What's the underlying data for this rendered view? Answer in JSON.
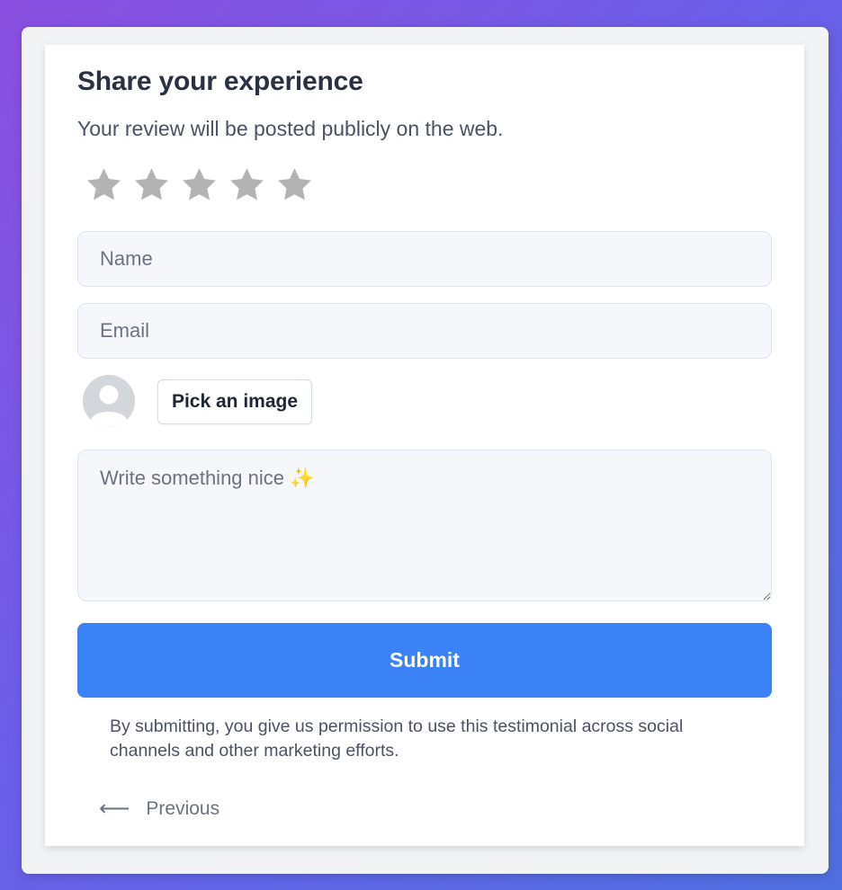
{
  "form": {
    "title": "Share your experience",
    "subtitle": "Your review will be posted publicly on the web.",
    "rating": {
      "max": 5,
      "selected": 0,
      "star_color": "#b3b3b3"
    },
    "name_placeholder": "Name",
    "name_value": "",
    "email_placeholder": "Email",
    "email_value": "",
    "avatar_icon": "user-avatar-placeholder-icon",
    "pick_image_label": "Pick an image",
    "message_placeholder": "Write something nice ✨",
    "message_value": "",
    "submit_label": "Submit",
    "disclaimer": "By submitting, you give us permission to use this testimonial across social channels and other marketing efforts.",
    "previous_label": "Previous",
    "previous_icon": "arrow-left-icon"
  },
  "colors": {
    "accent": "#3b82f6",
    "star": "#b3b3b3",
    "title": "#2a3142",
    "muted": "#6b7280"
  }
}
